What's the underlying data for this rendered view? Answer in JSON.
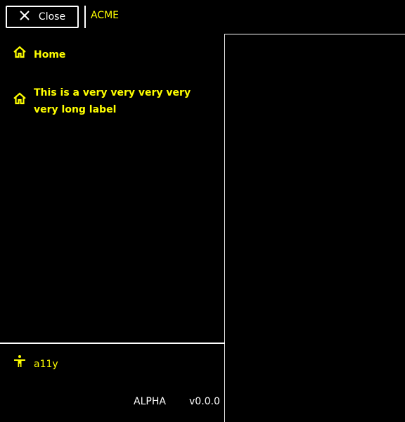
{
  "header": {
    "close_label": "Close",
    "brand": "ACME"
  },
  "nav": {
    "items": [
      {
        "icon": "home-icon",
        "label": "Home"
      },
      {
        "icon": "home-icon",
        "label": "This is a very very very very very long label"
      }
    ],
    "bottom_item": {
      "icon": "accessibility-icon",
      "label": "a11y"
    }
  },
  "footer": {
    "stage": "ALPHA",
    "version": "v0.0.0"
  },
  "colors": {
    "accent": "#ffff00",
    "foreground": "#ffffff",
    "background": "#000000"
  }
}
